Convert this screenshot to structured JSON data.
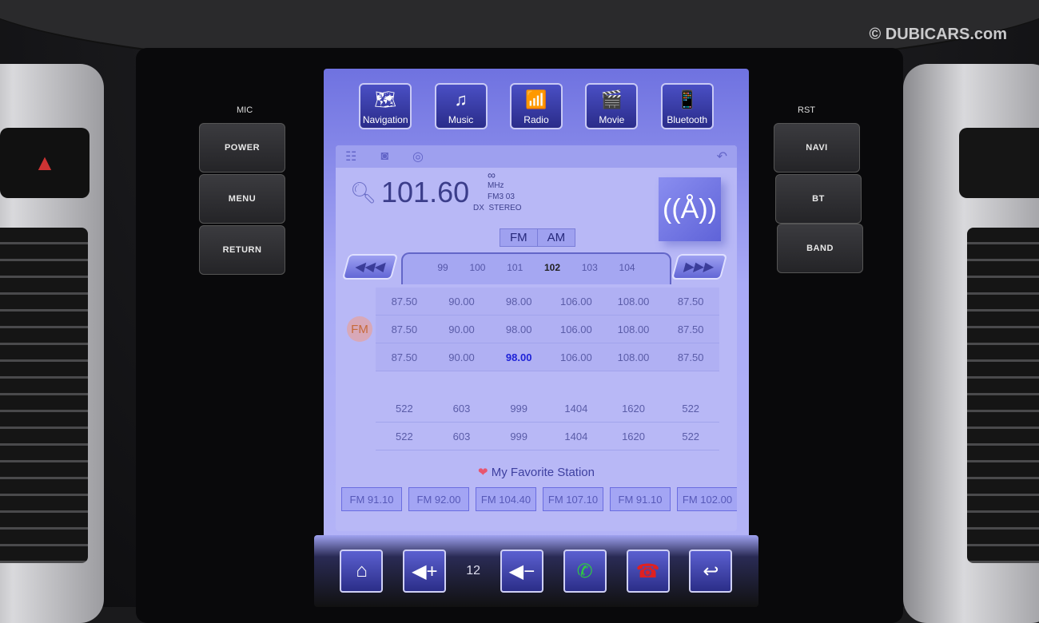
{
  "watermark": "© DUBICARS.com",
  "hardware_left": {
    "mic": "MIC",
    "buttons": [
      "POWER",
      "MENU",
      "RETURN"
    ]
  },
  "hardware_right": {
    "rst": "RST",
    "buttons": [
      "NAVI",
      "BT",
      "BAND"
    ]
  },
  "apps": [
    {
      "label": "Navigation",
      "icon": "map-icon"
    },
    {
      "label": "Music",
      "icon": "music-note-icon"
    },
    {
      "label": "Radio",
      "icon": "radio-icon"
    },
    {
      "label": "Movie",
      "icon": "clapper-icon"
    },
    {
      "label": "Bluetooth",
      "icon": "bluetooth-icon"
    }
  ],
  "radio": {
    "frequency": "101.60",
    "loop_symbol": "∞",
    "unit": "MHz",
    "band_preset": "FM3  03",
    "dx": "DX",
    "stereo": "STEREO",
    "band_tabs": [
      "FM",
      "AM"
    ],
    "dial_ticks": [
      "99",
      "100",
      "101",
      "102",
      "103",
      "104"
    ],
    "dial_active": "102",
    "fm_badge": "FM",
    "fm_rows": [
      [
        "87.50",
        "90.00",
        "98.00",
        "106.00",
        "108.00",
        "87.50"
      ],
      [
        "87.50",
        "90.00",
        "98.00",
        "106.00",
        "108.00",
        "87.50"
      ],
      [
        "87.50",
        "90.00",
        "98.00",
        "106.00",
        "108.00",
        "87.50"
      ]
    ],
    "fm_selected": "98.00",
    "am_rows": [
      [
        "522",
        "603",
        "999",
        "1404",
        "1620",
        "522"
      ],
      [
        "522",
        "603",
        "999",
        "1404",
        "1620",
        "522"
      ]
    ],
    "favorite_title": "My Favorite Station",
    "favorites": [
      "FM 91.10",
      "FM 92.00",
      "FM 104.40",
      "FM 107.10",
      "FM 91.10",
      "FM 102.00"
    ]
  },
  "bottom": {
    "volume": "12"
  },
  "colors": {
    "screen": "#b8b8f6",
    "selected": "#1e22d8",
    "call": "#2ecc40",
    "hangup": "#e02020"
  }
}
